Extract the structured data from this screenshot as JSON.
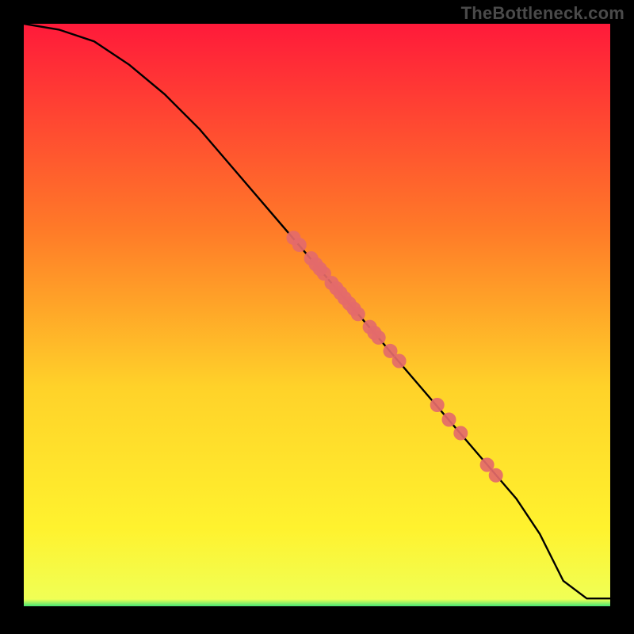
{
  "watermark": "TheBottleneck.com",
  "colors": {
    "bg": "#000000",
    "gradient_top": "#ff1a3a",
    "gradient_mid1": "#ff7a28",
    "gradient_mid2": "#ffd229",
    "gradient_mid3": "#fff22e",
    "gradient_bottom": "#1fe07a",
    "line": "#000000",
    "dot": "#e46a6a",
    "watermark": "#4a4a4a"
  },
  "chart_data": {
    "type": "line",
    "title": "",
    "xlabel": "",
    "ylabel": "",
    "xlim": [
      0,
      100
    ],
    "ylim": [
      0,
      100
    ],
    "grid": false,
    "legend": false,
    "line": {
      "x": [
        0,
        6,
        12,
        18,
        24,
        30,
        36,
        42,
        48,
        54,
        60,
        66,
        72,
        78,
        84,
        88,
        92,
        96,
        100
      ],
      "y": [
        100,
        99,
        97,
        93,
        88,
        82,
        75,
        68,
        61,
        54,
        47,
        40,
        33,
        26,
        19,
        13,
        5,
        2,
        2
      ]
    },
    "dots": [
      {
        "x": 46.0,
        "y": 63.5
      },
      {
        "x": 47.0,
        "y": 62.3
      },
      {
        "x": 49.0,
        "y": 60.0
      },
      {
        "x": 49.8,
        "y": 59.0
      },
      {
        "x": 50.5,
        "y": 58.2
      },
      {
        "x": 51.2,
        "y": 57.4
      },
      {
        "x": 52.5,
        "y": 55.8
      },
      {
        "x": 53.3,
        "y": 54.9
      },
      {
        "x": 54.0,
        "y": 54.1
      },
      {
        "x": 54.7,
        "y": 53.2
      },
      {
        "x": 55.5,
        "y": 52.3
      },
      {
        "x": 56.3,
        "y": 51.4
      },
      {
        "x": 57.0,
        "y": 50.5
      },
      {
        "x": 59.0,
        "y": 48.3
      },
      {
        "x": 59.8,
        "y": 47.3
      },
      {
        "x": 60.5,
        "y": 46.5
      },
      {
        "x": 62.5,
        "y": 44.2
      },
      {
        "x": 64.0,
        "y": 42.5
      },
      {
        "x": 70.5,
        "y": 35.0
      },
      {
        "x": 72.5,
        "y": 32.5
      },
      {
        "x": 74.5,
        "y": 30.2
      },
      {
        "x": 79.0,
        "y": 24.8
      },
      {
        "x": 80.5,
        "y": 23.0
      }
    ],
    "dot_radius_px": 9
  }
}
